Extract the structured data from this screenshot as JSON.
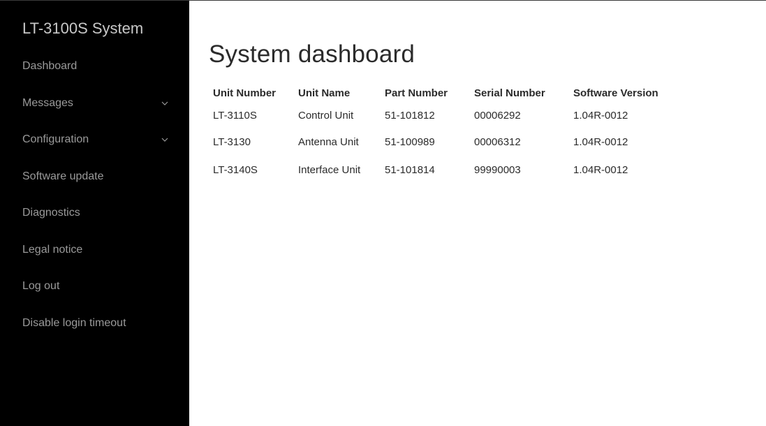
{
  "app": {
    "title": "LT-3100S System"
  },
  "sidebar": {
    "items": [
      {
        "label": "Dashboard",
        "expandable": false
      },
      {
        "label": "Messages",
        "expandable": true,
        "icon": "chevron-down-icon"
      },
      {
        "label": "Configuration",
        "expandable": true,
        "icon": "chevron-down-icon"
      },
      {
        "label": "Software update",
        "expandable": false
      },
      {
        "label": "Diagnostics",
        "expandable": false
      },
      {
        "label": "Legal notice",
        "expandable": false
      },
      {
        "label": "Log out",
        "expandable": false
      },
      {
        "label": "Disable login timeout",
        "expandable": false
      }
    ]
  },
  "main": {
    "title": "System dashboard",
    "table": {
      "headers": [
        "Unit Number",
        "Unit Name",
        "Part Number",
        "Serial Number",
        "Software Version"
      ],
      "rows": [
        [
          "LT-3110S",
          "Control Unit",
          "51-101812",
          "00006292",
          "1.04R-0012"
        ],
        [
          "LT-3130",
          "Antenna Unit",
          "51-100989",
          "00006312",
          "1.04R-0012"
        ],
        [
          "LT-3140S",
          "Interface Unit",
          "51-101814",
          "99990003",
          "1.04R-0012"
        ]
      ]
    }
  },
  "colors": {
    "sidebar_background": "#000000",
    "sidebar_text": "#9a9a9a",
    "brand_text": "#c8c8c8",
    "main_background": "#ffffff",
    "main_text": "#2b2b2b"
  }
}
